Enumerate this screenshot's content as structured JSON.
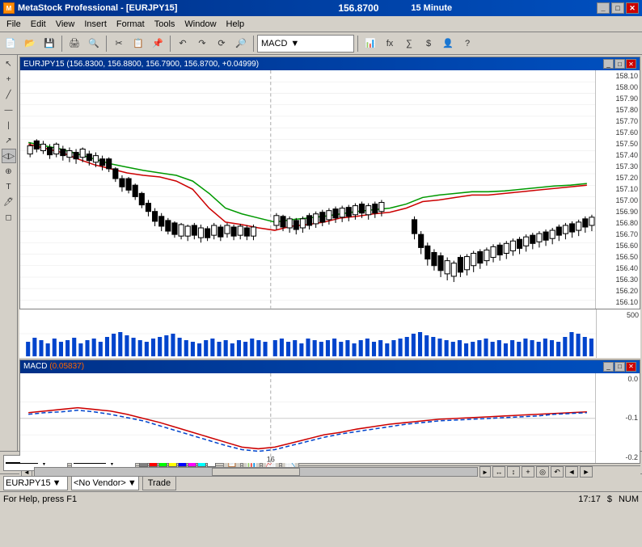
{
  "titleBar": {
    "title": "MetaStock Professional - [EURJPY15]",
    "price": "156.8700",
    "timeframe": "15 Minute",
    "btns": [
      "_",
      "□",
      "✕"
    ]
  },
  "menuBar": {
    "items": [
      "File",
      "Edit",
      "View",
      "Insert",
      "Format",
      "Tools",
      "Window",
      "Help"
    ]
  },
  "priceChart": {
    "title": "EURJPY15 (156.8300, 156.8800, 156.7900, 156.8700, +0.04999)",
    "priceLabels": [
      "158.10",
      "158.00",
      "157.90",
      "157.80",
      "157.70",
      "157.60",
      "157.50",
      "157.40",
      "157.30",
      "157.20",
      "157.10",
      "157.00",
      "156.90",
      "156.80",
      "156.70",
      "156.60",
      "156.50",
      "156.40",
      "156.30",
      "156.20",
      "156.10"
    ],
    "rightLabels": [
      "158.10",
      "158.00",
      "157.90",
      "157.80",
      "157.70",
      "157.60",
      "157.50",
      "157.40",
      "157.30",
      "157.20",
      "157.10",
      "157.00",
      "156.90",
      "156.80",
      "156.70",
      "156.60",
      "156.50",
      "156.40",
      "156.30",
      "156.20",
      "156.10"
    ]
  },
  "volumeChart": {
    "leftLabel": "500",
    "rightLabel": "500"
  },
  "macdChart": {
    "title": "MACD (0.05837)",
    "titleColor": "#ff6600",
    "labels": [
      "0.0",
      "-0.1",
      "-0.2"
    ],
    "rightLabels": [
      "0.0",
      "-0.1",
      "-0.2"
    ],
    "dateLabel": "16"
  },
  "scrollbar": {
    "icons": [
      "↔",
      "↕",
      "+",
      "◎",
      "↶",
      "←",
      "→"
    ]
  },
  "bottomToolbar": {
    "lineOptions": [
      "—",
      "- -",
      "···"
    ],
    "colors": [
      "#000000",
      "#800000",
      "#008000",
      "#808000",
      "#000080",
      "#800080",
      "#008080",
      "#c0c0c0",
      "#808080",
      "#ff0000",
      "#00ff00",
      "#ffff00",
      "#0000ff",
      "#ff00ff",
      "#00ffff",
      "#ffffff",
      "#ff8000",
      "#0080ff",
      "#8000ff",
      "#ff0080"
    ],
    "toolBtns": [
      "📋",
      "📊",
      "📈",
      "📉"
    ]
  },
  "symbolRow": {
    "symbol": "EURJPY15",
    "vendor": "No Vendor",
    "tradeLabel": "Trade"
  },
  "statusBar": {
    "helpText": "For Help, press F1",
    "time": "17:17",
    "currency": "$",
    "mode": "NUM"
  },
  "toolbar": {
    "indicatorDropdown": "MACD"
  }
}
